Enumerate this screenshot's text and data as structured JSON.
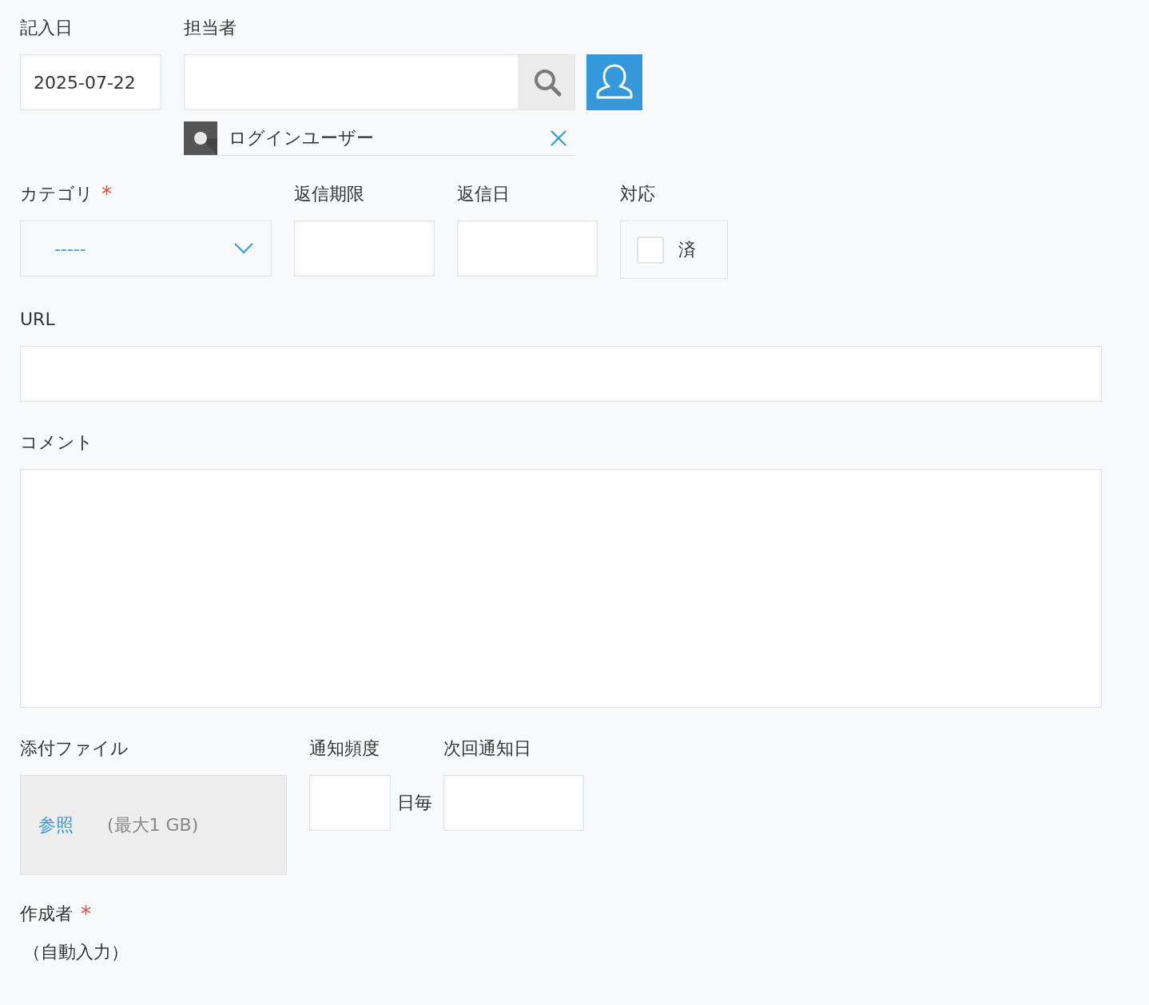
{
  "record_date": {
    "label": "記入日",
    "value": "2025-07-22"
  },
  "assignee": {
    "label": "担当者",
    "users": [
      {
        "name": "ログインユーザー"
      }
    ]
  },
  "category": {
    "label": "カテゴリ",
    "required_mark": "*",
    "value": "-----"
  },
  "reply_deadline": {
    "label": "返信期限"
  },
  "reply_date": {
    "label": "返信日"
  },
  "response": {
    "label": "対応",
    "option": {
      "label": "済",
      "checked": false
    }
  },
  "url": {
    "label": "URL"
  },
  "comment": {
    "label": "コメント"
  },
  "attachment": {
    "label": "添付ファイル",
    "browse": "参照",
    "limit": "(最大1 GB)"
  },
  "notify_frequency": {
    "label": "通知頻度",
    "unit": "日毎"
  },
  "next_notify": {
    "label": "次回通知日"
  },
  "creator": {
    "label": "作成者",
    "required_mark": "*",
    "value": "（自動入力）"
  }
}
